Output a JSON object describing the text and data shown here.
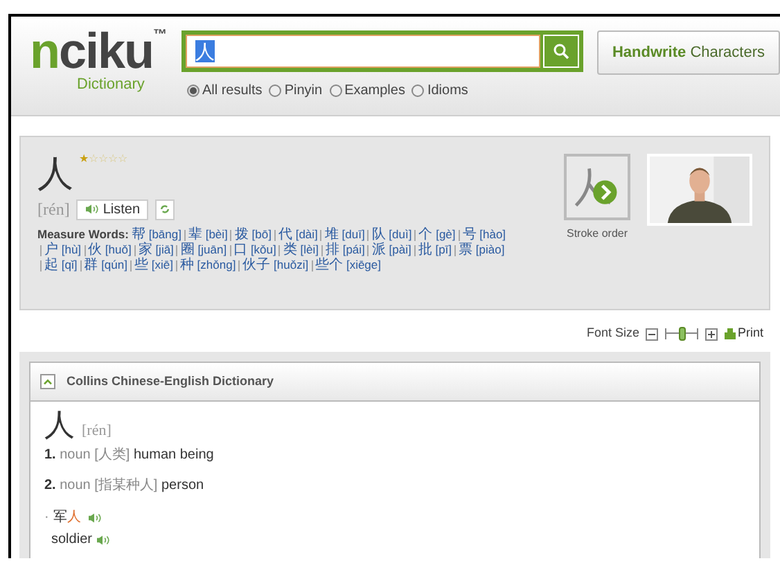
{
  "logo": {
    "name": "nciku",
    "trademark": "™",
    "subtitle": "Dictionary"
  },
  "search": {
    "value": "人"
  },
  "handwrite_button": {
    "bold": "Handwrite",
    "rest": "Characters"
  },
  "search_modes": [
    {
      "label": "All results",
      "selected": true
    },
    {
      "label": "Pinyin",
      "selected": false
    },
    {
      "label": "Examples",
      "selected": false
    },
    {
      "label": "Idioms",
      "selected": false
    }
  ],
  "entry": {
    "character": "人",
    "stars": 1,
    "pinyin": "[rén]",
    "listen_button": "Listen",
    "measure_words_label": "Measure Words:",
    "measure_words": [
      {
        "hanzi": "帮",
        "pinyin": "[bāng]"
      },
      {
        "hanzi": "辈",
        "pinyin": "[bèi]"
      },
      {
        "hanzi": "拨",
        "pinyin": "[bō]"
      },
      {
        "hanzi": "代",
        "pinyin": "[dài]"
      },
      {
        "hanzi": "堆",
        "pinyin": "[duī]"
      },
      {
        "hanzi": "队",
        "pinyin": "[duì]"
      },
      {
        "hanzi": "个",
        "pinyin": "[gè]"
      },
      {
        "hanzi": "号",
        "pinyin": "[hào]"
      },
      {
        "hanzi": "户",
        "pinyin": "[hù]"
      },
      {
        "hanzi": "伙",
        "pinyin": "[huǒ]"
      },
      {
        "hanzi": "家",
        "pinyin": "[jiā]"
      },
      {
        "hanzi": "圈",
        "pinyin": "[juān]"
      },
      {
        "hanzi": "口",
        "pinyin": "[kǒu]"
      },
      {
        "hanzi": "类",
        "pinyin": "[lèi]"
      },
      {
        "hanzi": "排",
        "pinyin": "[pái]"
      },
      {
        "hanzi": "派",
        "pinyin": "[pài]"
      },
      {
        "hanzi": "批",
        "pinyin": "[pī]"
      },
      {
        "hanzi": "票",
        "pinyin": "[piào]"
      },
      {
        "hanzi": "起",
        "pinyin": "[qǐ]"
      },
      {
        "hanzi": "群",
        "pinyin": "[qún]"
      },
      {
        "hanzi": "些",
        "pinyin": "[xiē]"
      },
      {
        "hanzi": "种",
        "pinyin": "[zhǒng]"
      },
      {
        "hanzi": "伙子",
        "pinyin": "[huǒzi]"
      },
      {
        "hanzi": "些个",
        "pinyin": "[xiēge]"
      }
    ],
    "stroke_order_label": "Stroke order"
  },
  "toolbar": {
    "font_size_label": "Font Size",
    "font_slider": {
      "level": 0.5
    },
    "print_label": "Print"
  },
  "dictionary": {
    "title": "Collins Chinese-English Dictionary",
    "expanded": true,
    "character": "人",
    "pinyin": "[rén]",
    "items": [
      {
        "kind": "sense",
        "number": "1.",
        "pos": "noun",
        "gloss": "[人类]",
        "meaning": "human being"
      },
      {
        "kind": "sense",
        "number": "2.",
        "pos": "noun",
        "gloss": "[指某种人]",
        "meaning": "person"
      },
      {
        "kind": "example",
        "bullet": "·",
        "prefix": "军",
        "highlight": "人",
        "translation": "soldier"
      }
    ]
  }
}
